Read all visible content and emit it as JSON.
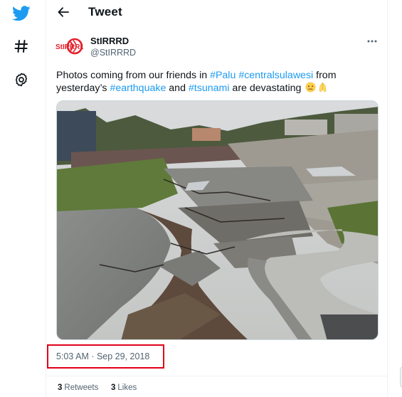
{
  "nav": {
    "icons": [
      "twitter-logo-icon",
      "hashtag-icon",
      "settings-gear-icon"
    ]
  },
  "header": {
    "title": "Tweet"
  },
  "author": {
    "name": "StIRRRD",
    "handle": "@StIRRRD",
    "avatar_text": "StIRRRD"
  },
  "tweet": {
    "text_1": "Photos coming from our friends in ",
    "tag_1": "#Palu",
    "text_2": " ",
    "tag_2": "#centralsulawesi",
    "text_3": " from yesterday’s ",
    "tag_3": "#earthquake",
    "text_4": " and ",
    "tag_4": "#tsunami",
    "text_5": " are devastating ",
    "emojis": [
      "crying-face-emoji",
      "folded-hands-emoji"
    ],
    "photo": "earthquake-damaged-road-photo",
    "timestamp": "5:03 AM · Sep 29, 2018"
  },
  "stats": {
    "retweets_count": "3",
    "retweets_label": "Retweets",
    "likes_count": "3",
    "likes_label": "Likes"
  },
  "colors": {
    "accent": "#1d9bf0",
    "text": "#0f1419",
    "muted": "#536471",
    "highlight_box": "#e0001b",
    "brand_red": "#e4202b"
  }
}
